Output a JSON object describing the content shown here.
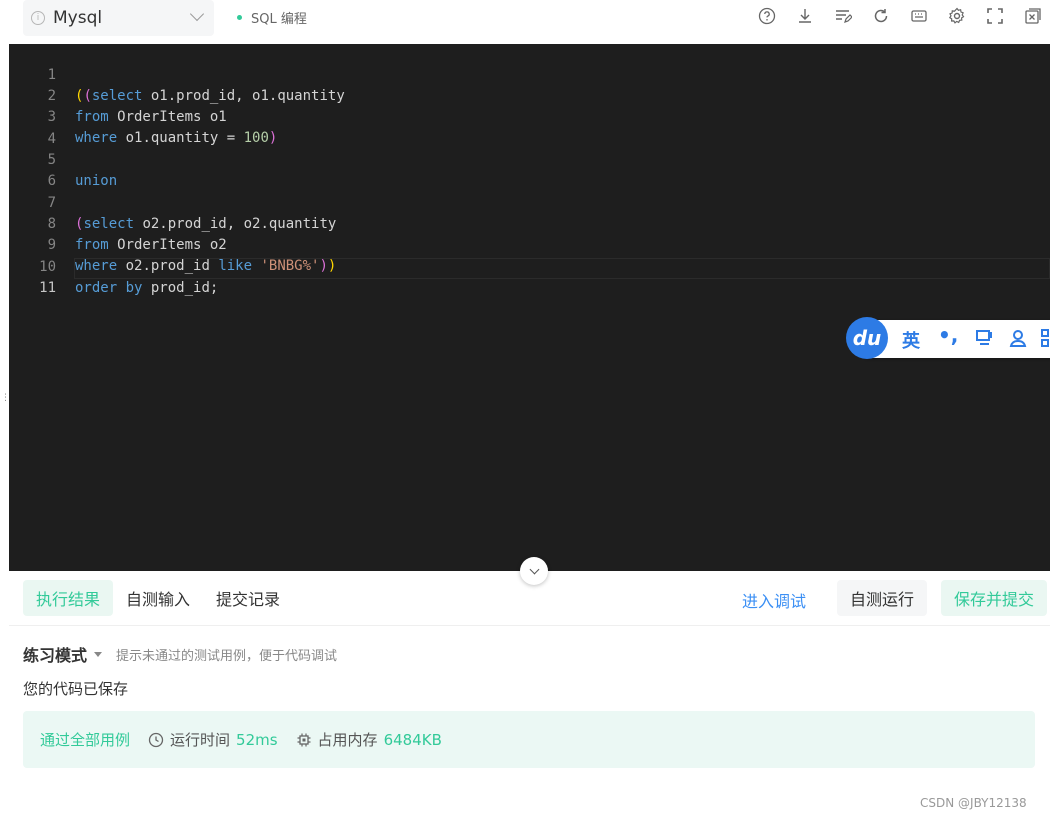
{
  "toolbar": {
    "language": "Mysql",
    "mode_label": "SQL 编程",
    "icons": [
      "help-icon",
      "download-icon",
      "format-icon",
      "reset-icon",
      "keyboard-icon",
      "settings-icon",
      "fullscreen-icon",
      "close-icon"
    ]
  },
  "editor": {
    "line_numbers": [
      "1",
      "2",
      "3",
      "4",
      "5",
      "6",
      "7",
      "8",
      "9",
      "10",
      "11"
    ],
    "active_line": 11
  },
  "ime": {
    "logo": "du",
    "lang": "英",
    "punct": "•,"
  },
  "tabs": {
    "result": "执行结果",
    "custom_input": "自测输入",
    "history": "提交记录"
  },
  "actions": {
    "debug": "进入调试",
    "run": "自测运行",
    "submit": "保存并提交"
  },
  "result": {
    "mode_title": "练习模式",
    "mode_hint": "提示未通过的测试用例，便于代码调试",
    "saved_message": "您的代码已保存",
    "status": "通过全部用例",
    "runtime_label": "运行时间",
    "runtime_value": "52ms",
    "memory_label": "占用内存",
    "memory_value": "6484KB"
  },
  "watermark": "CSDN @JBY12138"
}
